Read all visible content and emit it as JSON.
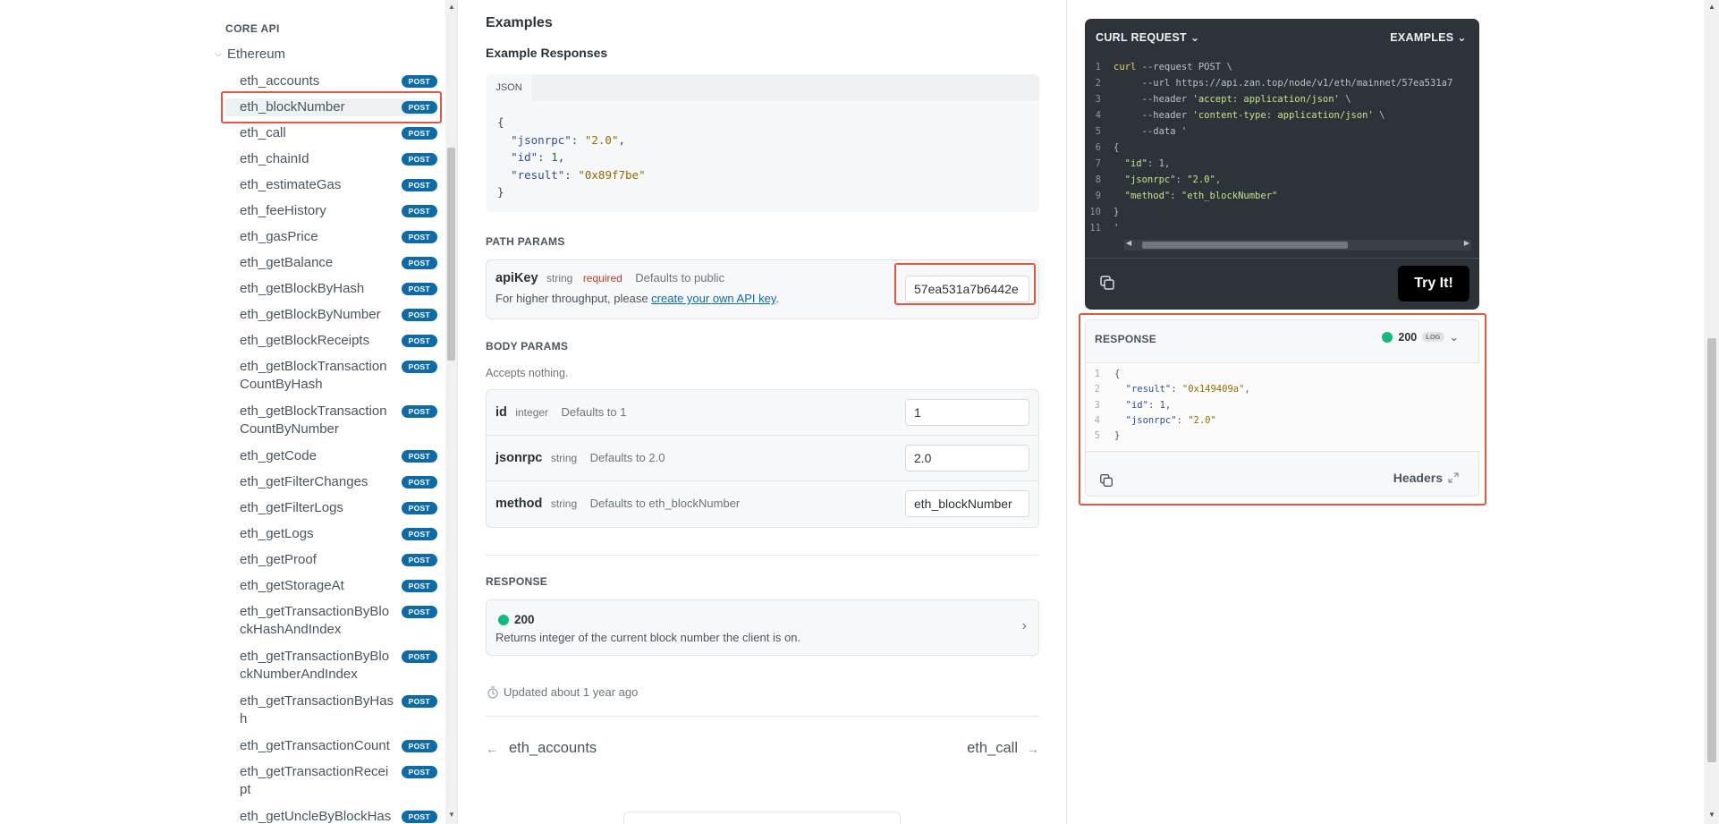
{
  "sidebar": {
    "section_title": "CORE API",
    "group_label": "Ethereum",
    "method_badge": "POST",
    "items": [
      {
        "label": "eth_accounts"
      },
      {
        "label": "eth_blockNumber"
      },
      {
        "label": "eth_call"
      },
      {
        "label": "eth_chainId"
      },
      {
        "label": "eth_estimateGas"
      },
      {
        "label": "eth_feeHistory"
      },
      {
        "label": "eth_gasPrice"
      },
      {
        "label": "eth_getBalance"
      },
      {
        "label": "eth_getBlockByHash"
      },
      {
        "label": "eth_getBlockByNumber"
      },
      {
        "label": "eth_getBlockReceipts"
      },
      {
        "label": "eth_getBlockTransaction CountByHash"
      },
      {
        "label": "eth_getBlockTransaction CountByNumber"
      },
      {
        "label": "eth_getCode"
      },
      {
        "label": "eth_getFilterChanges"
      },
      {
        "label": "eth_getFilterLogs"
      },
      {
        "label": "eth_getLogs"
      },
      {
        "label": "eth_getProof"
      },
      {
        "label": "eth_getStorageAt"
      },
      {
        "label": "eth_getTransactionByBlo ckHashAndIndex"
      },
      {
        "label": "eth_getTransactionByBlo ckNumberAndIndex"
      },
      {
        "label": "eth_getTransactionByHas h"
      },
      {
        "label": "eth_getTransactionCount"
      },
      {
        "label": "eth_getTransactionRecei pt"
      },
      {
        "label": "eth_getUncleByBlockHas"
      }
    ],
    "active_index": 1
  },
  "main": {
    "examples_title": "Examples",
    "example_responses_title": "Example Responses",
    "code_tab": "JSON",
    "example_json": {
      "open": "{",
      "jsonrpc_key": "\"jsonrpc\"",
      "jsonrpc_val": "\"2.0\"",
      "id_key": "\"id\"",
      "id_val": "1",
      "result_key": "\"result\"",
      "result_val": "\"0x89f7be\"",
      "close": "}"
    },
    "path_params_title": "PATH PARAMS",
    "path_params": {
      "name": "apiKey",
      "type": "string",
      "required": "required",
      "default": "Defaults to public",
      "desc_prefix": "For higher throughput, please ",
      "desc_link": "create your own API key",
      "desc_suffix": ".",
      "value": "57ea531a7b6442e"
    },
    "body_params_title": "BODY PARAMS",
    "body_params_note": "Accepts nothing.",
    "body_params": [
      {
        "name": "id",
        "type": "integer",
        "default": "Defaults to 1",
        "value": "1"
      },
      {
        "name": "jsonrpc",
        "type": "string",
        "default": "Defaults to 2.0",
        "value": "2.0"
      },
      {
        "name": "method",
        "type": "string",
        "default": "Defaults to eth_blockNumber",
        "value": "eth_blockNumber"
      }
    ],
    "response_title": "RESPONSE",
    "response": {
      "code": "200",
      "desc": "Returns integer of the current block number the client is on."
    },
    "updated": "Updated about 1 year ago",
    "prev_page": "eth_accounts",
    "next_page": "eth_call"
  },
  "right": {
    "curl_title": "CURL REQUEST",
    "examples_label": "EXAMPLES",
    "curl_lines": [
      {
        "n": "1",
        "parts": [
          [
            "cmd",
            "curl"
          ],
          [
            "flag",
            " --request POST \\"
          ]
        ]
      },
      {
        "n": "2",
        "parts": [
          [
            "flag",
            "     --url https://api.zan.top/node/v1/eth/mainnet/57ea531a7"
          ]
        ]
      },
      {
        "n": "3",
        "parts": [
          [
            "flag",
            "     --header "
          ],
          [
            "str",
            "'accept: application/json'"
          ],
          [
            "flag",
            " \\"
          ]
        ]
      },
      {
        "n": "4",
        "parts": [
          [
            "flag",
            "     --header "
          ],
          [
            "str",
            "'content-type: application/json'"
          ],
          [
            "flag",
            " \\"
          ]
        ]
      },
      {
        "n": "5",
        "parts": [
          [
            "flag",
            "     --data '"
          ]
        ]
      },
      {
        "n": "6",
        "parts": [
          [
            "flag",
            "{"
          ]
        ]
      },
      {
        "n": "7",
        "parts": [
          [
            "key",
            "  \"id\""
          ],
          [
            "flag",
            ": 1,"
          ]
        ]
      },
      {
        "n": "8",
        "parts": [
          [
            "key",
            "  \"jsonrpc\""
          ],
          [
            "flag",
            ": "
          ],
          [
            "str",
            "\"2.0\""
          ],
          [
            "flag",
            ","
          ]
        ]
      },
      {
        "n": "9",
        "parts": [
          [
            "key",
            "  \"method\""
          ],
          [
            "flag",
            ": "
          ],
          [
            "str",
            "\"eth_blockNumber\""
          ]
        ]
      },
      {
        "n": "10",
        "parts": [
          [
            "flag",
            "}"
          ]
        ]
      },
      {
        "n": "11",
        "parts": [
          [
            "flag",
            "'"
          ]
        ]
      }
    ],
    "try_button": "Try It!",
    "response_title": "RESPONSE",
    "response_code": "200",
    "log_badge": "LOG",
    "response_lines": [
      {
        "n": "1",
        "parts": [
          [
            "rt",
            "{"
          ]
        ]
      },
      {
        "n": "2",
        "parts": [
          [
            "rk",
            "  \"result\""
          ],
          [
            "rt",
            ": "
          ],
          [
            "rs",
            "\"0x149409a\""
          ],
          [
            "rt",
            ","
          ]
        ]
      },
      {
        "n": "3",
        "parts": [
          [
            "rk",
            "  \"id\""
          ],
          [
            "rt",
            ": 1,"
          ]
        ]
      },
      {
        "n": "4",
        "parts": [
          [
            "rk",
            "  \"jsonrpc\""
          ],
          [
            "rt",
            ": "
          ],
          [
            "rs",
            "\"2.0\""
          ]
        ]
      },
      {
        "n": "5",
        "parts": [
          [
            "rt",
            "}"
          ]
        ]
      }
    ],
    "headers_label": "Headers"
  },
  "colors": {
    "accent_badge": "#0e6ba8",
    "highlight_outline": "#e4573d",
    "status_ok": "#12ba7d",
    "code_panel_bg": "#2d3338"
  }
}
